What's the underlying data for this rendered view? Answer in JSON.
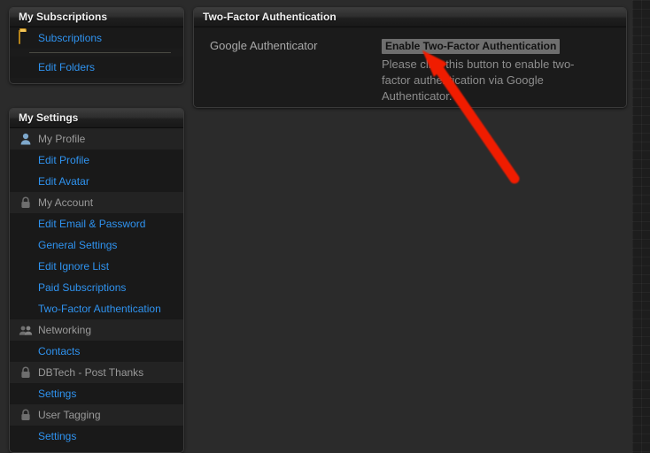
{
  "colors": {
    "link": "#2f93f0",
    "page_background": "#2b2b2b",
    "panel_background": "#1b1b1b",
    "section_text": "#9a9a9a",
    "annotation_arrow": "#f01a00",
    "button_background": "#6e6e6e",
    "folder_icon": "#f5b93c"
  },
  "sidebar": {
    "subscriptions_block": {
      "title": "My Subscriptions",
      "items": [
        {
          "label": "Subscriptions",
          "type": "link",
          "icon": "folder-icon"
        },
        {
          "label": "Edit Folders",
          "type": "link",
          "icon": ""
        }
      ]
    },
    "settings_block": {
      "title": "My Settings",
      "items": [
        {
          "label": "My Profile",
          "type": "section",
          "icon": "person-icon"
        },
        {
          "label": "Edit Profile",
          "type": "link",
          "icon": ""
        },
        {
          "label": "Edit Avatar",
          "type": "link",
          "icon": ""
        },
        {
          "label": "My Account",
          "type": "section",
          "icon": "lock-icon"
        },
        {
          "label": "Edit Email & Password",
          "type": "link",
          "icon": ""
        },
        {
          "label": "General Settings",
          "type": "link",
          "icon": ""
        },
        {
          "label": "Edit Ignore List",
          "type": "link",
          "icon": ""
        },
        {
          "label": "Paid Subscriptions",
          "type": "link",
          "icon": ""
        },
        {
          "label": "Two-Factor Authentication",
          "type": "link",
          "icon": ""
        },
        {
          "label": "Networking",
          "type": "section",
          "icon": "people-icon"
        },
        {
          "label": "Contacts",
          "type": "link",
          "icon": ""
        },
        {
          "label": "DBTech - Post Thanks",
          "type": "section",
          "icon": "lock-icon"
        },
        {
          "label": "Settings",
          "type": "link",
          "icon": ""
        },
        {
          "label": "User Tagging",
          "type": "section",
          "icon": "lock-icon"
        },
        {
          "label": "Settings",
          "type": "link",
          "icon": ""
        }
      ]
    }
  },
  "main": {
    "panel_title": "Two-Factor Authentication",
    "field": {
      "label": "Google Authenticator",
      "button_label": "Enable Two-Factor Authentication",
      "description": "Please click this button to enable two-factor authentication via Google Authenticator."
    }
  }
}
